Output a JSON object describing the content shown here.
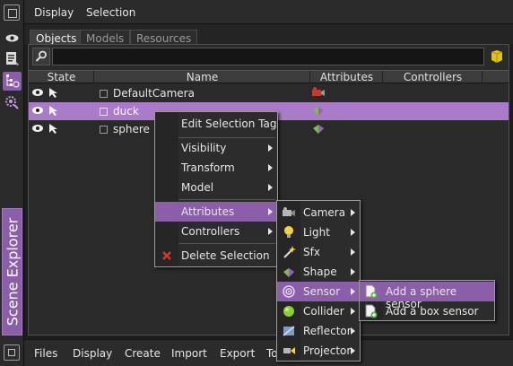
{
  "top_menu": {
    "display": "Display",
    "selection": "Selection"
  },
  "side_title": "Scene Explorer",
  "tabs": [
    {
      "label": "Objects"
    },
    {
      "label": "Models"
    },
    {
      "label": "Resources"
    }
  ],
  "search": {
    "value": "",
    "placeholder": ""
  },
  "columns": {
    "state": "State",
    "name": "Name",
    "attributes": "Attributes",
    "controllers": "Controllers"
  },
  "rows": [
    {
      "name": "DefaultCamera",
      "attr_icon": "camera-icon",
      "selected": false
    },
    {
      "name": "duck",
      "attr_icon": "shape-icon",
      "selected": true
    },
    {
      "name": "sphere",
      "attr_icon": "shape-icon",
      "selected": false
    }
  ],
  "context_menu": {
    "items": [
      {
        "label": "Edit Selection Tag"
      },
      {
        "label": "Visibility"
      },
      {
        "label": "Transform"
      },
      {
        "label": "Model"
      },
      {
        "label": "Attributes"
      },
      {
        "label": "Controllers"
      },
      {
        "label": "Delete Selection"
      }
    ]
  },
  "attributes_menu": {
    "items": [
      {
        "label": "Camera",
        "icon": "camera-icon"
      },
      {
        "label": "Light",
        "icon": "lightbulb-icon"
      },
      {
        "label": "Sfx",
        "icon": "wand-icon"
      },
      {
        "label": "Shape",
        "icon": "shape-icon"
      },
      {
        "label": "Sensor",
        "icon": "sensor-icon"
      },
      {
        "label": "Collider",
        "icon": "collider-icon"
      },
      {
        "label": "Reflector",
        "icon": "reflector-icon"
      },
      {
        "label": "Projector",
        "icon": "projector-icon"
      }
    ]
  },
  "sensor_menu": {
    "items": [
      {
        "label": "Add a sphere sensor"
      },
      {
        "label": "Add a box sensor"
      }
    ]
  },
  "bottom_menu": {
    "files": "Files",
    "display": "Display",
    "create": "Create",
    "import": "Import",
    "export": "Export",
    "tools": "To"
  },
  "colors": {
    "accent": "#8a5ea8",
    "selected_row": "#a97bc9",
    "background": "#2a2a2a"
  }
}
